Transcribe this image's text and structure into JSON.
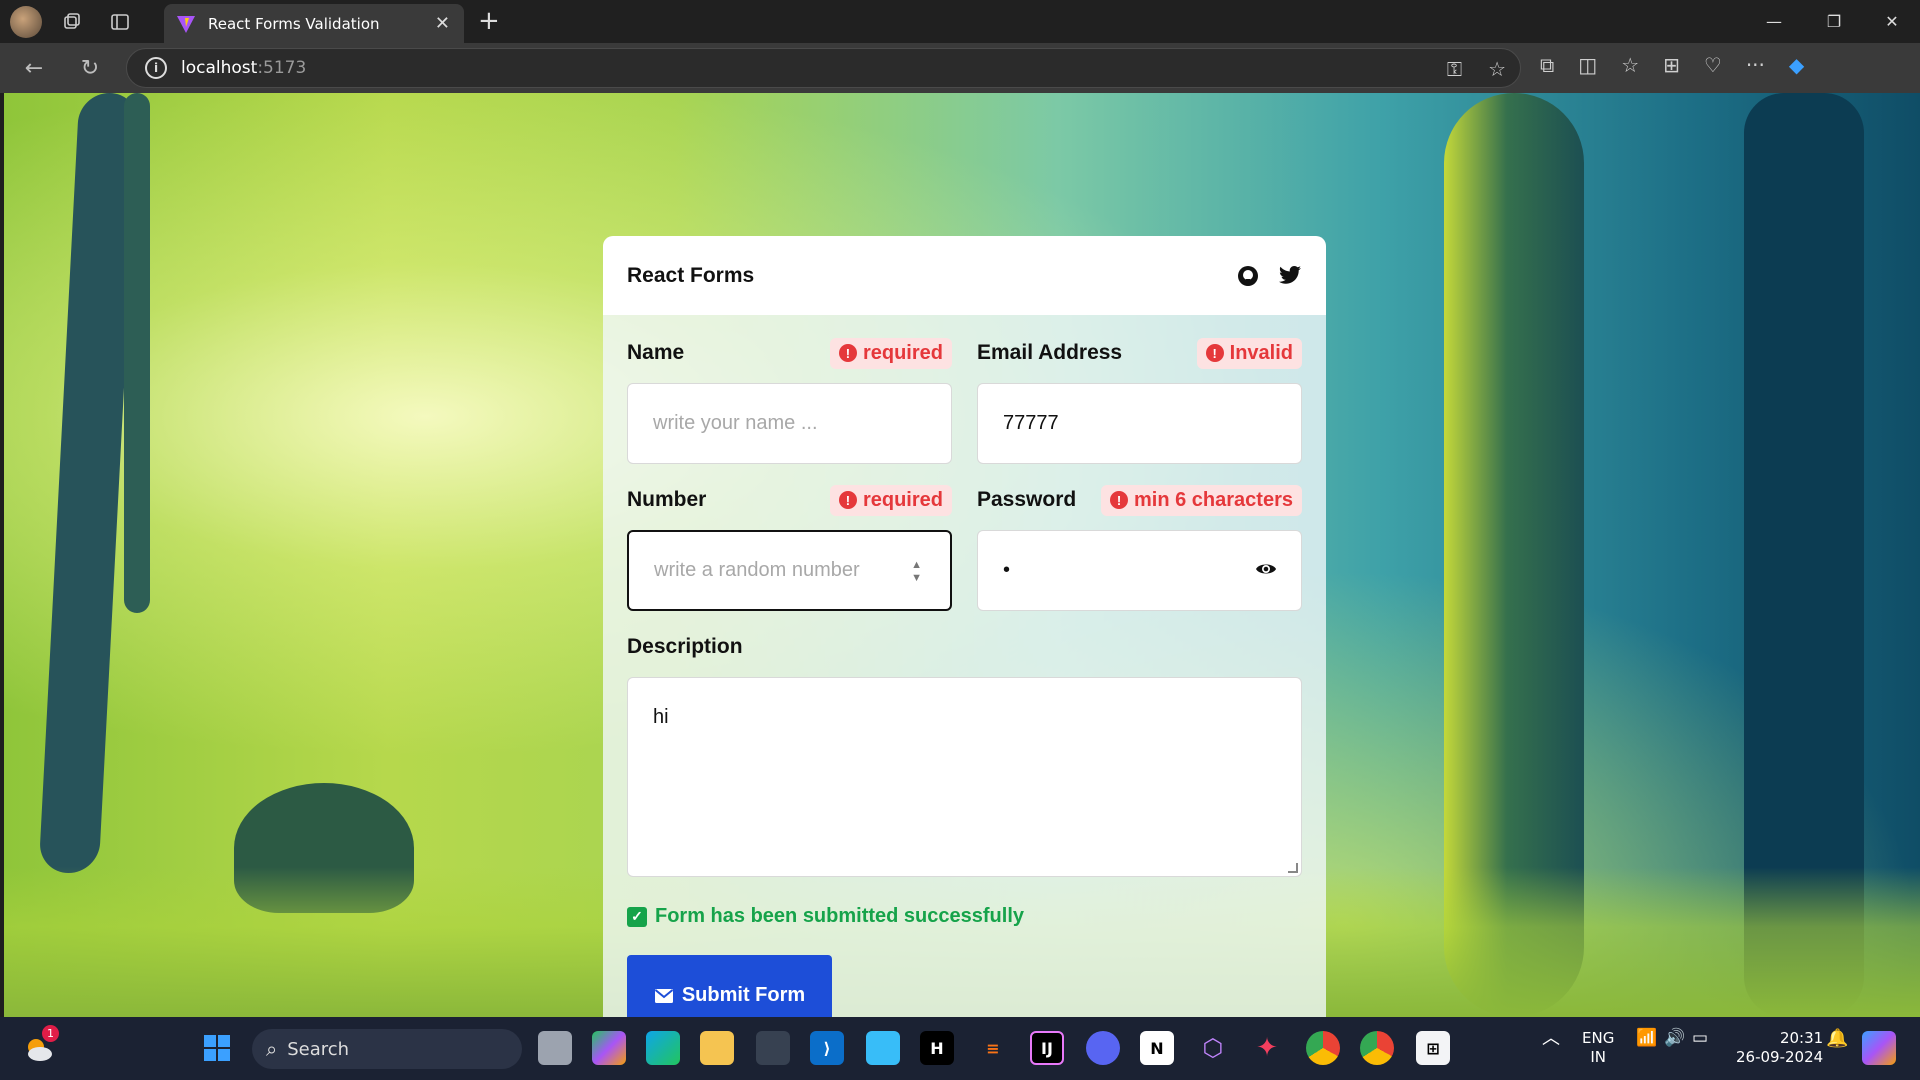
{
  "browser": {
    "tab_title": "React Forms Validation",
    "url_host": "localhost",
    "url_port": ":5173"
  },
  "card": {
    "title": "React Forms",
    "fields": {
      "name": {
        "label": "Name",
        "error": "required",
        "placeholder": "write your name ...",
        "value": ""
      },
      "email": {
        "label": "Email Address",
        "error": "Invalid",
        "value": "77777"
      },
      "number": {
        "label": "Number",
        "error": "required",
        "placeholder": "write a random number",
        "value": ""
      },
      "password": {
        "label": "Password",
        "error": "min 6 characters",
        "value": "•"
      },
      "description": {
        "label": "Description",
        "value": "hi"
      }
    },
    "success_message": "Form has been submitted successfully",
    "submit_label": "Submit Form"
  },
  "taskbar": {
    "search_label": "Search",
    "language_top": "ENG",
    "language_bottom": "IN",
    "time": "20:31",
    "date": "26-09-2024",
    "weather_badge": "1"
  },
  "colors": {
    "error": "#e5383b",
    "error_bg": "#fde2e2",
    "success": "#16a34a",
    "submit": "#1d4ed8"
  }
}
